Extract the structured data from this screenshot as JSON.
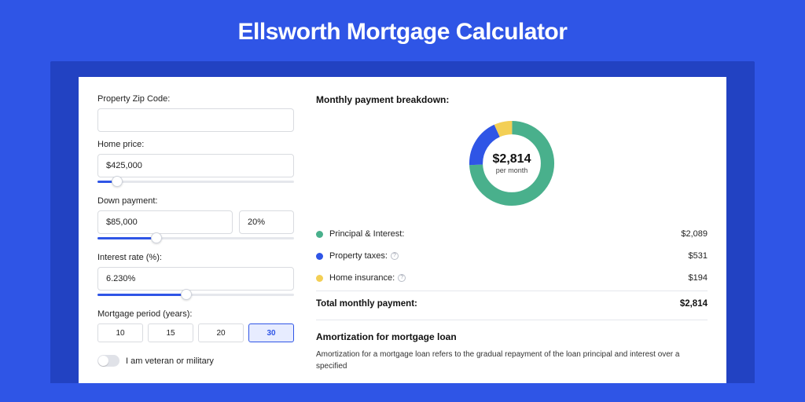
{
  "title": "Ellsworth Mortgage Calculator",
  "form": {
    "zip": {
      "label": "Property Zip Code:",
      "value": ""
    },
    "price": {
      "label": "Home price:",
      "value": "$425,000",
      "slider_pct": 10
    },
    "down": {
      "label": "Down payment:",
      "value": "$85,000",
      "pct_value": "20%",
      "slider_pct": 30
    },
    "rate": {
      "label": "Interest rate (%):",
      "value": "6.230%",
      "slider_pct": 45
    },
    "period": {
      "label": "Mortgage period (years):",
      "options": [
        "10",
        "15",
        "20",
        "30"
      ],
      "active": "30"
    },
    "veteran": {
      "label": "I am veteran or military",
      "on": false
    }
  },
  "breakdown": {
    "heading": "Monthly payment breakdown:",
    "total_value": "$2,814",
    "total_sub": "per month",
    "items": [
      {
        "label": "Principal & Interest:",
        "value": "$2,089",
        "color": "#49b08c",
        "info": false
      },
      {
        "label": "Property taxes:",
        "value": "$531",
        "color": "#2f55e6",
        "info": true
      },
      {
        "label": "Home insurance:",
        "value": "$194",
        "color": "#f3cf55",
        "info": true
      }
    ],
    "total_label": "Total monthly payment:",
    "total_amount": "$2,814"
  },
  "amort": {
    "heading": "Amortization for mortgage loan",
    "body": "Amortization for a mortgage loan refers to the gradual repayment of the loan principal and interest over a specified"
  },
  "chart_data": {
    "type": "pie",
    "title": "Monthly payment breakdown",
    "series": [
      {
        "name": "Principal & Interest",
        "value": 2089,
        "color": "#49b08c"
      },
      {
        "name": "Property taxes",
        "value": 531,
        "color": "#2f55e6"
      },
      {
        "name": "Home insurance",
        "value": 194,
        "color": "#f3cf55"
      }
    ],
    "total": 2814,
    "unit": "USD per month"
  }
}
